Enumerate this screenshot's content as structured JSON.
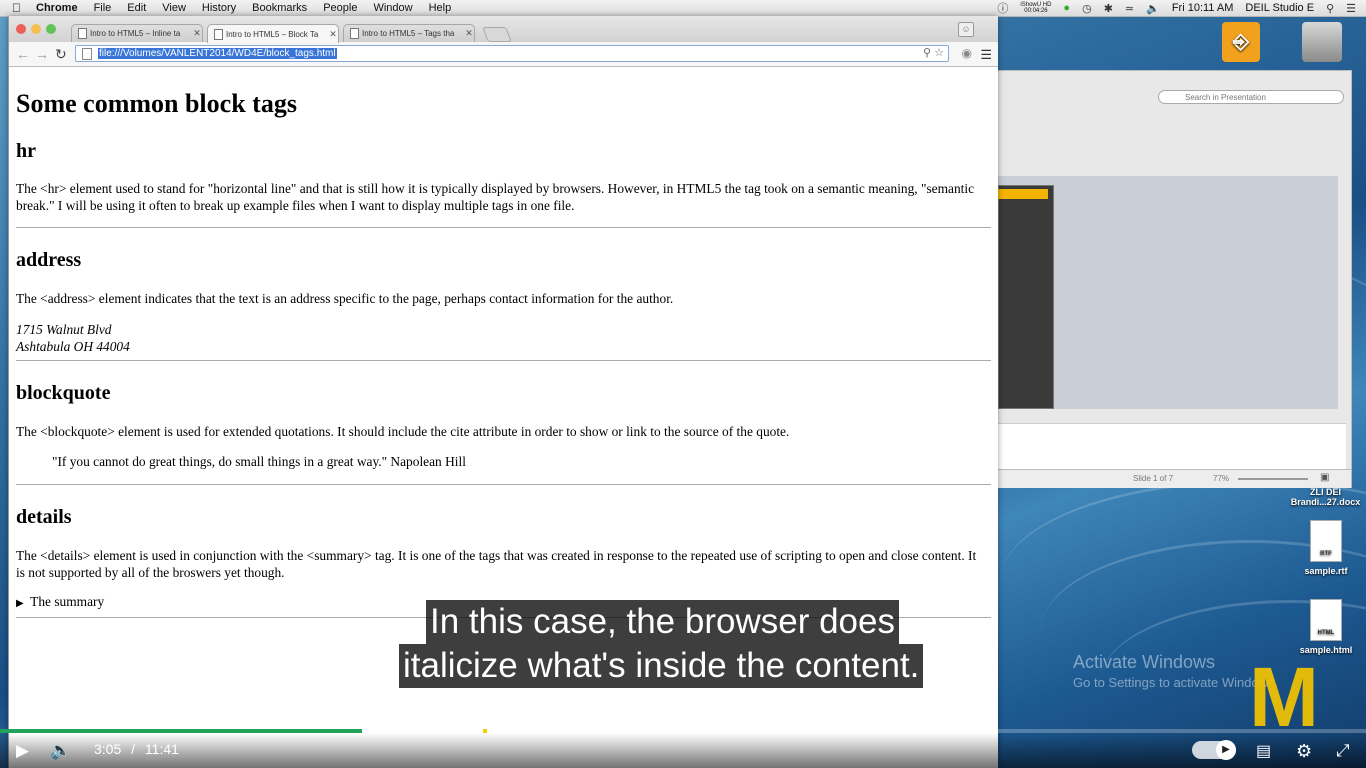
{
  "menubar": {
    "app": "Chrome",
    "items": [
      "File",
      "Edit",
      "View",
      "History",
      "Bookmarks",
      "People",
      "Window",
      "Help"
    ],
    "recorder": "iShowU HD",
    "recorder_time": "00:04:26",
    "clock": "Fri 10:11 AM",
    "user": "DEIL Studio E"
  },
  "browser": {
    "tabs": [
      {
        "label": "Intro to HTML5 – Inline ta"
      },
      {
        "label": "Intro to HTML5 – Block Ta"
      },
      {
        "label": "Intro to HTML5 – Tags tha"
      }
    ],
    "url": "file:///Volumes/VANLENT2014/WD4E/block_tags.html"
  },
  "page": {
    "title": "Some common block tags",
    "sections": [
      {
        "heading": "hr",
        "text": "The <hr> element used to stand for \"horizontal line\" and that is still how it is typically displayed by browsers. However, in HTML5 the tag took on a semantic meaning, \"semantic break.\" I will be using it often to break up example files when I want to display multiple tags in one file."
      },
      {
        "heading": "address",
        "text": "The <address> element indicates that the text is an address specific to the page, perhaps contact information for the author.",
        "address_line1": "1715 Walnut Blvd",
        "address_line2": "Ashtabula OH 44004"
      },
      {
        "heading": "blockquote",
        "text": "The <blockquote> element is used for extended quotations. It should include the cite attribute in order to show or link to the source of the quote.",
        "quote": "\"If you cannot do great things, do small things in a great way.\" Napolean Hill"
      },
      {
        "heading": "details",
        "text": "The <details> element is used in conjunction with the <summary> tag. It is one of the tags that was created in response to the repeated use of scripting to open and close content. It is not supported by all of the broswers yet though.",
        "summary": "The summary"
      }
    ]
  },
  "video": {
    "caption_line1": "In this case, the browser does",
    "caption_line2": "italicize what's inside the content.",
    "current_time": "3:05",
    "separator": "/",
    "duration": "11:41",
    "played_fraction": 0.265,
    "buffered_fraction": 0.355
  },
  "watermark": {
    "title": "Activate Windows",
    "subtitle": "Go to Settings to activate Windows."
  },
  "powerpoint": {
    "search_placeholder": "Search in Presentation",
    "slide_status": "Slide 1 of 7",
    "zoom": "77%"
  },
  "desktop_icons": [
    {
      "label_line1": "ZLI DEI",
      "label_line2": "Brandi...27.docx"
    },
    {
      "label": "sample.rtf",
      "badge": "RTF"
    },
    {
      "label": "sample.html",
      "badge": "HTML"
    }
  ],
  "colors": {
    "progress_played": "#22a35a",
    "chapter_marker": "#f3d000",
    "url_highlight": "#3875d7",
    "logo": "#f4c400"
  }
}
